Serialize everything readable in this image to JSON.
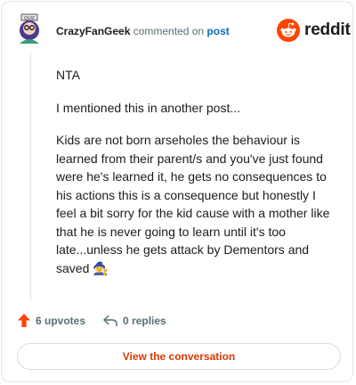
{
  "header": {
    "username": "CrazyFanGeek",
    "action_text": " commented on ",
    "post_link": "post"
  },
  "brand": {
    "wordmark": "reddit",
    "accent": "#ff4500"
  },
  "comment": {
    "paragraphs": [
      "NTA",
      "I mentioned this in another post...",
      "Kids are not born arseholes the behaviour is learned from their parent/s and you've just found were he's learned it, he gets no consequences to his actions this is a consequence but honestly I feel a bit sorry for the kid cause with a mother like that he is never going to learn until it's too late...unless he gets attack by Dementors and saved 🧙‍♀️"
    ]
  },
  "actions": {
    "upvotes": "6 upvotes",
    "replies": "0 replies"
  },
  "cta": {
    "view_conversation": "View the conversation"
  }
}
